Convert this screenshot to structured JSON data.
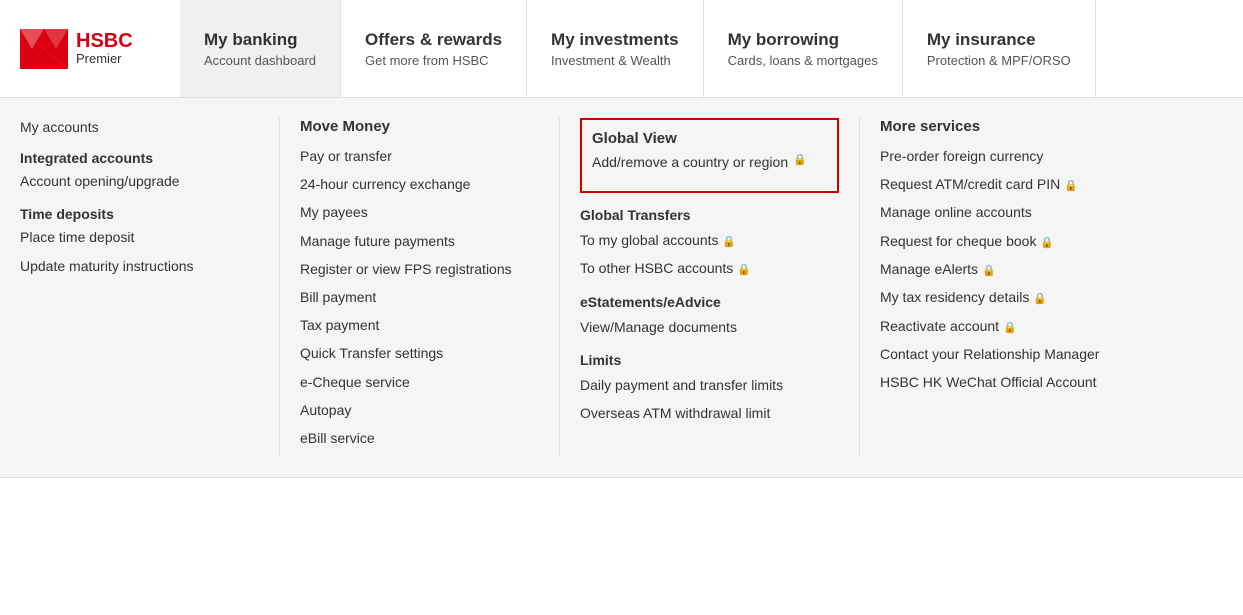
{
  "header": {
    "logo": {
      "name": "HSBC",
      "subtitle": "Premier"
    },
    "nav": [
      {
        "title": "My banking",
        "subtitle": "Account dashboard",
        "active": true
      },
      {
        "title": "Offers & rewards",
        "subtitle": "Get more from HSBC",
        "active": false
      },
      {
        "title": "My investments",
        "subtitle": "Investment & Wealth",
        "active": false
      },
      {
        "title": "My borrowing",
        "subtitle": "Cards, loans & mortgages",
        "active": false
      },
      {
        "title": "My insurance",
        "subtitle": "Protection & MPF/ORSO",
        "active": false
      }
    ]
  },
  "dropdown": {
    "col1": {
      "sections": [
        {
          "items": [
            {
              "label": "My accounts",
              "bold": false,
              "lock": false
            }
          ]
        },
        {
          "title": "Integrated accounts",
          "items": [
            {
              "label": "Account opening/upgrade",
              "bold": false,
              "lock": false
            }
          ]
        },
        {
          "title": "Time deposits",
          "items": [
            {
              "label": "Place time deposit",
              "bold": false,
              "lock": false
            },
            {
              "label": "Update maturity instructions",
              "bold": false,
              "lock": false
            }
          ]
        }
      ]
    },
    "col2": {
      "title": "Move Money",
      "items": [
        {
          "label": "Pay or transfer",
          "lock": false
        },
        {
          "label": "24-hour currency exchange",
          "lock": false
        },
        {
          "label": "My payees",
          "lock": false
        },
        {
          "label": "Manage future payments",
          "lock": false
        },
        {
          "label": "Register or view FPS registrations",
          "lock": false
        },
        {
          "label": "Bill payment",
          "lock": false
        },
        {
          "label": "Tax payment",
          "lock": false
        },
        {
          "label": "Quick Transfer settings",
          "lock": false
        },
        {
          "label": "e-Cheque service",
          "lock": false
        },
        {
          "label": "Autopay",
          "lock": false
        },
        {
          "label": "eBill service",
          "lock": false
        }
      ]
    },
    "col3": {
      "globalView": {
        "title": "Global View",
        "link": "Add/remove a country or region",
        "lock": true,
        "highlighted": true
      },
      "sections": [
        {
          "title": "Global Transfers",
          "items": [
            {
              "label": "To my global accounts",
              "lock": true
            },
            {
              "label": "To other HSBC accounts",
              "lock": true
            }
          ]
        },
        {
          "title": "eStatements/eAdvice",
          "items": [
            {
              "label": "View/Manage documents",
              "lock": false
            }
          ]
        },
        {
          "title": "Limits",
          "items": [
            {
              "label": "Daily payment and transfer limits",
              "lock": false
            },
            {
              "label": "Overseas ATM withdrawal limit",
              "lock": false
            }
          ]
        }
      ]
    },
    "col4": {
      "title": "More services",
      "items": [
        {
          "label": "Pre-order foreign currency",
          "lock": false
        },
        {
          "label": "Request ATM/credit card PIN",
          "lock": true
        },
        {
          "label": "Manage online accounts",
          "lock": false
        },
        {
          "label": "Request for cheque book",
          "lock": true
        },
        {
          "label": "Manage eAlerts",
          "lock": true
        },
        {
          "label": "My tax residency details",
          "lock": true
        },
        {
          "label": "Reactivate account",
          "lock": true
        },
        {
          "label": "Contact your Relationship Manager",
          "lock": false
        },
        {
          "label": "HSBC HK WeChat Official Account",
          "lock": false
        }
      ]
    }
  }
}
